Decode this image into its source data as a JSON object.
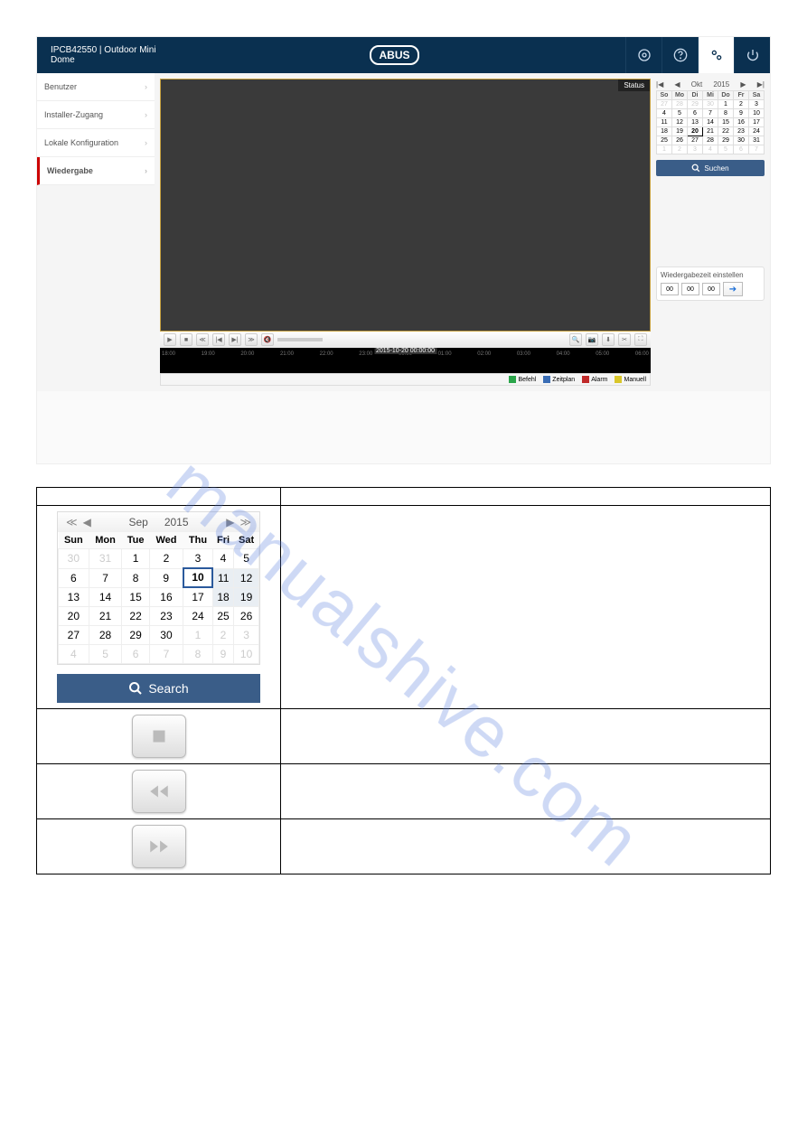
{
  "header": {
    "device": "IPCB42550  |  Outdoor Mini Dome",
    "logo": "ABUS"
  },
  "sidebar": {
    "items": [
      {
        "label": "Benutzer"
      },
      {
        "label": "Installer-Zugang"
      },
      {
        "label": "Lokale Konfiguration"
      },
      {
        "label": "Wiedergabe"
      }
    ]
  },
  "video": {
    "status": "Status"
  },
  "timeline": {
    "timestamp": "2015-10-20 00:00:00",
    "ticks": [
      "18:00",
      "19:00",
      "20:00",
      "21:00",
      "22:00",
      "23:00",
      "00:00",
      "01:00",
      "02:00",
      "03:00",
      "04:00",
      "05:00",
      "06:00"
    ]
  },
  "legend": {
    "items": [
      {
        "label": "Befehl",
        "color": "#2aa54a"
      },
      {
        "label": "Zeitplan",
        "color": "#3a6db5"
      },
      {
        "label": "Alarm",
        "color": "#c02a2a"
      },
      {
        "label": "Manuell",
        "color": "#d9c62a"
      }
    ]
  },
  "calendar_small": {
    "month": "Okt",
    "year": "2015",
    "dow": [
      "So",
      "Mo",
      "Di",
      "Mi",
      "Do",
      "Fr",
      "Sa"
    ],
    "rows": [
      [
        27,
        28,
        29,
        30,
        1,
        2,
        3
      ],
      [
        4,
        5,
        6,
        7,
        8,
        9,
        10
      ],
      [
        11,
        12,
        13,
        14,
        15,
        16,
        17
      ],
      [
        18,
        19,
        20,
        21,
        22,
        23,
        24
      ],
      [
        25,
        26,
        27,
        28,
        29,
        30,
        31
      ],
      [
        1,
        2,
        3,
        4,
        5,
        6,
        7
      ]
    ],
    "today": 20
  },
  "search_btn": "Suchen",
  "time_panel": {
    "title": "Wiedergabezeit einstellen",
    "h": "00",
    "m": "00",
    "s": "00"
  },
  "doc_calendar": {
    "month": "Sep",
    "year": "2015",
    "dow": [
      "Sun",
      "Mon",
      "Tue",
      "Wed",
      "Thu",
      "Fri",
      "Sat"
    ],
    "rows": [
      [
        30,
        31,
        1,
        2,
        3,
        4,
        5
      ],
      [
        6,
        7,
        8,
        9,
        10,
        11,
        12
      ],
      [
        13,
        14,
        15,
        16,
        17,
        18,
        19
      ],
      [
        20,
        21,
        22,
        23,
        24,
        25,
        26
      ],
      [
        27,
        28,
        29,
        30,
        1,
        2,
        3
      ],
      [
        4,
        5,
        6,
        7,
        8,
        9,
        10
      ]
    ],
    "selected": 10,
    "recordings": [
      5,
      11,
      12,
      18,
      19
    ]
  },
  "doc_search_btn": "Search",
  "watermark": "manualshive.com"
}
